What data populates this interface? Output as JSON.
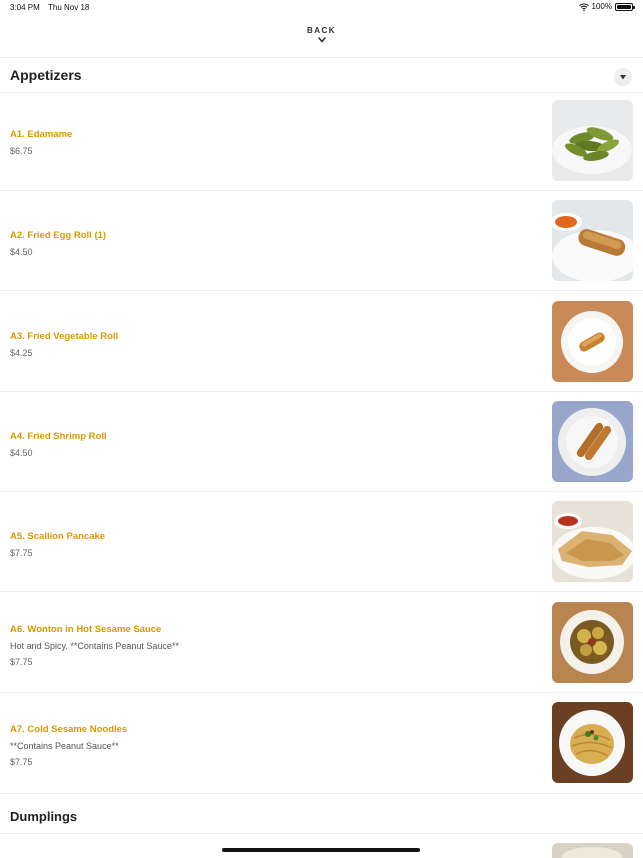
{
  "status_bar": {
    "time": "3:04 PM",
    "date": "Thu Nov 18",
    "battery": "100%"
  },
  "nav": {
    "back_label": "BACK"
  },
  "sections": [
    {
      "title": "Appetizers",
      "items": [
        {
          "name": "A1. Edamame",
          "description": "",
          "price": "$6.75"
        },
        {
          "name": "A2. Fried Egg Roll (1)",
          "description": "",
          "price": "$4.50"
        },
        {
          "name": "A3. Fried Vegetable Roll",
          "description": "",
          "price": "$4.25"
        },
        {
          "name": "A4. Fried Shrimp Roll",
          "description": "",
          "price": "$4.50"
        },
        {
          "name": "A5. Scallion Pancake",
          "description": "",
          "price": "$7.75"
        },
        {
          "name": "A6. Wonton in Hot Sesame Sauce",
          "description": "Hot and Spicy. **Contains Peanut Sauce**",
          "price": "$7.75"
        },
        {
          "name": "A7. Cold Sesame Noodles",
          "description": "**Contains Peanut Sauce**",
          "price": "$7.75"
        }
      ]
    },
    {
      "title": "Dumplings",
      "items": []
    }
  ],
  "colors": {
    "item_name": "#d89a00",
    "divider": "#ececec"
  }
}
